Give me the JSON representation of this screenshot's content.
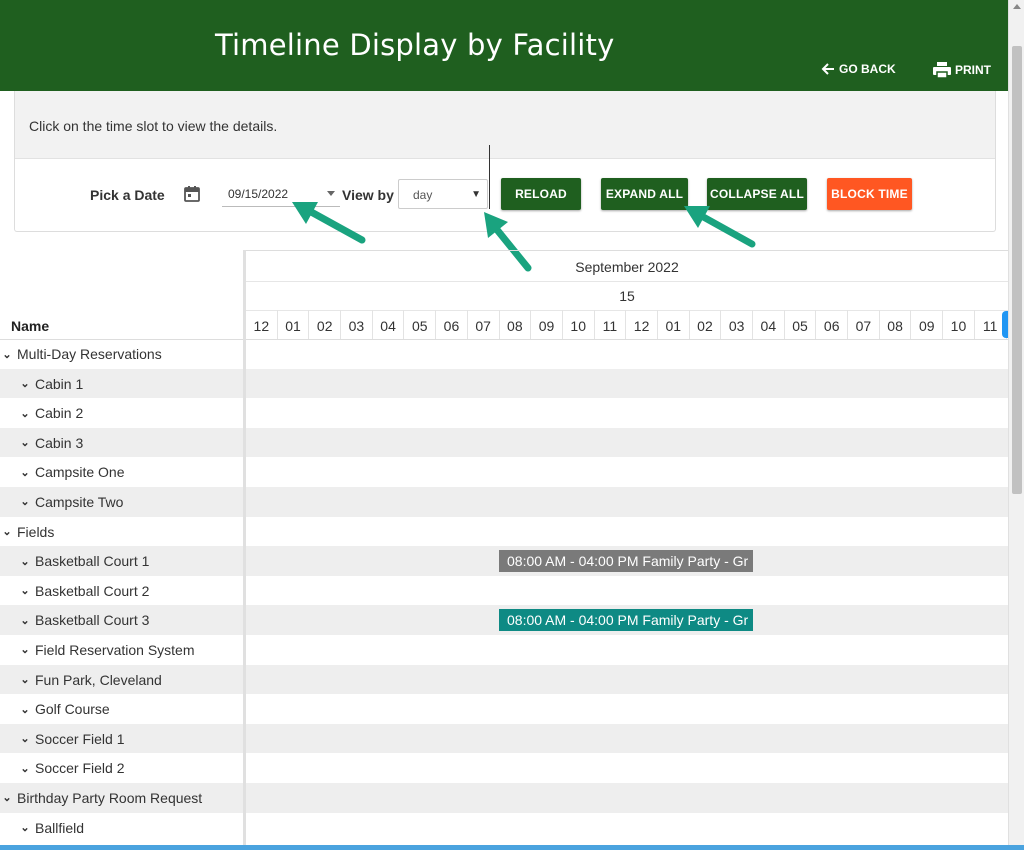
{
  "header": {
    "title": "Timeline Display by Facility",
    "go_back": "GO BACK",
    "print": "PRINT",
    "bg_color": "#1f5f1f"
  },
  "panel": {
    "info": "Click on the time slot to view the details.",
    "pick_date_label": "Pick a Date",
    "date_value": "09/15/2022",
    "view_by_label": "View by",
    "view_by_value": "day",
    "buttons": {
      "reload": "RELOAD",
      "expand_all": "EXPAND ALL",
      "collapse_all": "COLLAPSE ALL",
      "block_time": "BLOCK TIME"
    },
    "icons": [
      "calendar-icon",
      "chevron-down-icon"
    ],
    "colors": {
      "button_green": "#1f5f1f",
      "button_orange": "#ff5722",
      "arrow": "#1aa37f"
    }
  },
  "timeline": {
    "month": "September 2022",
    "day": "15",
    "name_header": "Name",
    "hours": [
      "12",
      "01",
      "02",
      "03",
      "04",
      "05",
      "06",
      "07",
      "08",
      "09",
      "10",
      "11",
      "12",
      "01",
      "02",
      "03",
      "04",
      "05",
      "06",
      "07",
      "08",
      "09",
      "10",
      "11"
    ],
    "rows": [
      {
        "label": "Multi-Day Reservations",
        "level": 0
      },
      {
        "label": "Cabin 1",
        "level": 1
      },
      {
        "label": "Cabin 2",
        "level": 1
      },
      {
        "label": "Cabin 3",
        "level": 1
      },
      {
        "label": "Campsite One",
        "level": 1
      },
      {
        "label": "Campsite Two",
        "level": 1
      },
      {
        "label": "Fields",
        "level": 0
      },
      {
        "label": "Basketball Court 1",
        "level": 1,
        "event": {
          "text": "08:00 AM - 04:00 PM Family Party - Gr",
          "color": "#7a7a7a"
        }
      },
      {
        "label": "Basketball Court 2",
        "level": 1
      },
      {
        "label": "Basketball Court 3",
        "level": 1,
        "event": {
          "text": "08:00 AM - 04:00 PM Family Party - Gr",
          "color": "#0e8a84"
        }
      },
      {
        "label": "Field Reservation System",
        "level": 1
      },
      {
        "label": "Fun Park, Cleveland",
        "level": 1
      },
      {
        "label": "Golf Course",
        "level": 1
      },
      {
        "label": "Soccer Field 1",
        "level": 1
      },
      {
        "label": "Soccer Field 2",
        "level": 1
      },
      {
        "label": "Birthday Party Room Request",
        "level": 0
      },
      {
        "label": "Ballfield",
        "level": 1
      }
    ]
  }
}
